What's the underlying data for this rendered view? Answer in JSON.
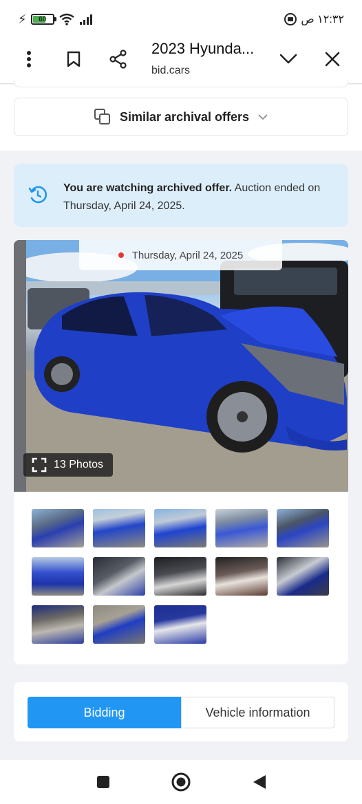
{
  "status": {
    "battery": "60",
    "battery_level": 0.6,
    "time": "١٢:٣٢ ص"
  },
  "browser": {
    "tab_title": "2023 Hyunda...",
    "url": "bid.cars"
  },
  "similar": {
    "label": "Similar archival offers"
  },
  "notice": {
    "bold": "You are watching archived offer.",
    "text": " Auction ended on Thursday, April 24, 2025."
  },
  "gallery": {
    "date": "Thursday, April 24, 2025",
    "photo_count": "13 Photos"
  },
  "tabs": {
    "bidding": "Bidding",
    "vehicle": "Vehicle information"
  },
  "colors": {
    "accent": "#2196f3",
    "notice_bg": "#ddeefb",
    "car_blue": "#1f3fc7"
  }
}
